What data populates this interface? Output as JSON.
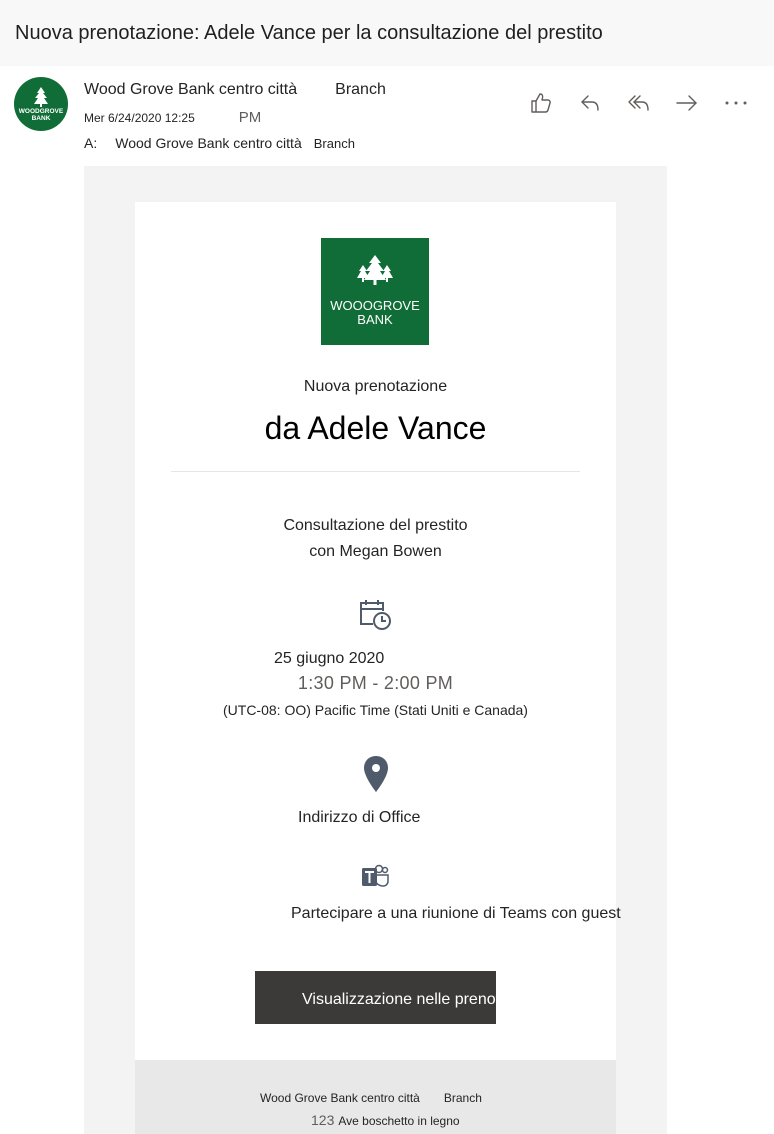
{
  "subject": "Nuova prenotazione: Adele Vance per la consultazione del prestito",
  "header": {
    "avatar_line1": "WOODGROVE",
    "avatar_line2": "BANK",
    "sender_name": "Wood Grove Bank centro città",
    "sender_tag": "Branch",
    "date": "Mer 6/24/2020 12:25",
    "date_pm": "PM",
    "to_label": "A:",
    "to_name": "Wood Grove Bank centro città",
    "to_tag": "Branch",
    "actions": [
      {
        "name": "like",
        "icon": "thumbs-up-icon"
      },
      {
        "name": "reply",
        "icon": "reply-icon"
      },
      {
        "name": "reply-all",
        "icon": "reply-all-icon"
      },
      {
        "name": "forward",
        "icon": "forward-icon"
      },
      {
        "name": "more",
        "icon": "more-icon"
      }
    ]
  },
  "card": {
    "logo_line1": "WOOOGROVE",
    "logo_line2": "BANK",
    "new_booking_label": "Nuova prenotazione",
    "customer": "da Adele Vance",
    "service": "Consultazione del prestito",
    "staff": "con Megan Bowen",
    "date": "25 giugno 2020",
    "time": "1:30 PM - 2:00 PM",
    "timezone": "(UTC-08: OO) Pacific Time (Stati Uniti e Canada)",
    "location": "Indirizzo di Office",
    "teams_text": "Partecipare a una riunione di Teams con guest",
    "view_button": "Visualizzazione nelle prenotazioni"
  },
  "footer": {
    "name": "Wood Grove Bank centro città",
    "tag": "Branch",
    "street_number": "123",
    "street": "Ave boschetto in legno"
  },
  "colors": {
    "brand_green": "#116d37",
    "button_dark": "#3b3a39",
    "icon_slate": "#4f5a6b"
  }
}
